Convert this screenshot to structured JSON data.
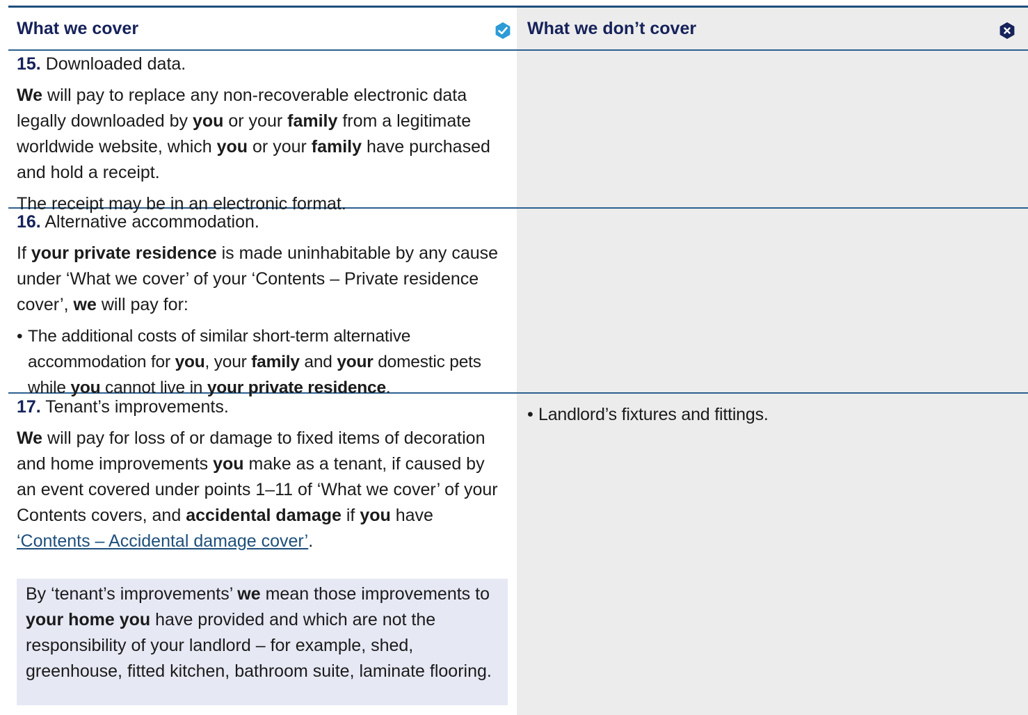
{
  "header": {
    "cover_title": "What we cover",
    "nocover_title": "What we don’t cover",
    "cover_icon": "check-badge-icon",
    "nocover_icon": "x-badge-icon",
    "brand_color": "#16225a",
    "check_color": "#2d9bd6"
  },
  "rows": [
    {
      "number": "15.",
      "heading": "Downloaded data.",
      "p1": {
        "t1": "We",
        "t2": " will pay to replace any non-recoverable electronic data legally downloaded by ",
        "t3": "you",
        "t4": " or your ",
        "t5": "family",
        "t6": " from a legitimate worldwide website, which ",
        "t7": "you",
        "t8": " or your ",
        "t9": "family",
        "t10": " have purchased and hold a receipt."
      },
      "p2": "The receipt may be in an electronic format."
    },
    {
      "number": "16.",
      "heading": "Alternative accommodation.",
      "p1": {
        "t1": "If ",
        "t2": "your private residence",
        "t3": " is made uninhabitable by any cause under ‘What we cover’ of your ‘Contents – Private residence cover’, ",
        "t4": "we",
        "t5": " will pay for:"
      },
      "bullet": {
        "t1": "The additional costs of similar short-term alternative accommodation for ",
        "t2": "you",
        "t3": ", your ",
        "t4": "family",
        "t5": " and ",
        "t6": "your",
        "t7": " domestic pets while ",
        "t8": "you",
        "t9": " cannot live in ",
        "t10": "your private residence",
        "t11": "."
      }
    },
    {
      "number": "17.",
      "heading": "Tenant’s improvements.",
      "p1": {
        "t1": "We",
        "t2": " will pay for loss of or damage to fixed items of decoration and home improvements ",
        "t3": "you",
        "t4": " make as a tenant, if caused by an event covered under points 1–11 of ‘What we cover’ of your Contents covers, and ",
        "t5": "accidental damage",
        "t6": " if ",
        "t7": "you",
        "t8": " have ",
        "link": "‘Contents – Accidental damage cover’",
        "t9": "."
      },
      "note": {
        "t1": "By ‘tenant’s improvements’ ",
        "t2": "we",
        "t3": " mean those improvements to ",
        "t4": "your home you",
        "t5": " have provided and which are not the responsibility of your landlord – for example, shed, greenhouse, fitted kitchen, bathroom suite, laminate flooring."
      },
      "not_covered": "Landlord’s fixtures and fittings."
    }
  ]
}
